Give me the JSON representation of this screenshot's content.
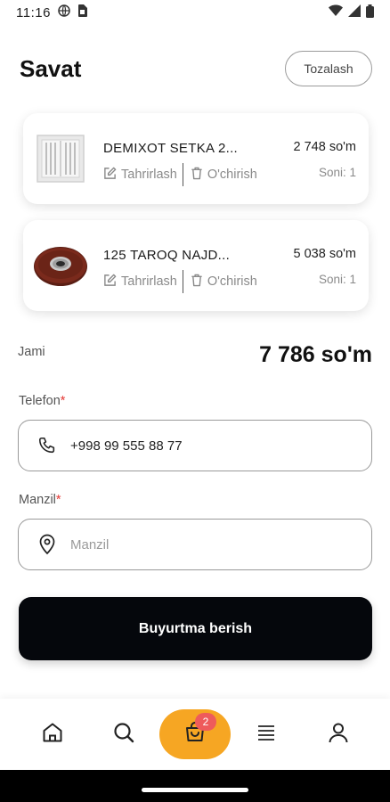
{
  "status_bar": {
    "time": "11:16"
  },
  "header": {
    "title": "Savat",
    "clear_label": "Tozalash"
  },
  "cart": {
    "items": [
      {
        "name": "DEMIXOT SETKA 2...",
        "price": "2 748 so'm",
        "edit_label": "Tahrirlash",
        "delete_label": "O'chirish",
        "quantity_label": "Soni: 1"
      },
      {
        "name": "125 TAROQ NAJD...",
        "price": "5 038 so'm",
        "edit_label": "Tahrirlash",
        "delete_label": "O'chirish",
        "quantity_label": "Soni: 1"
      }
    ]
  },
  "total": {
    "label": "Jami",
    "value": "7 786 so'm"
  },
  "form": {
    "phone": {
      "label": "Telefon",
      "required_mark": "*",
      "value": "+998 99 555 88 77"
    },
    "address": {
      "label": "Manzil",
      "required_mark": "*",
      "placeholder": "Manzil",
      "value": ""
    },
    "submit_label": "Buyurtma berish"
  },
  "bottom_nav": {
    "items": [
      "home-icon",
      "search-icon",
      "cart-icon",
      "menu-icon",
      "profile-icon"
    ],
    "active": "cart-icon",
    "cart_badge": "2",
    "accent_color": "#f6a623",
    "badge_color": "#ee5b5b"
  }
}
